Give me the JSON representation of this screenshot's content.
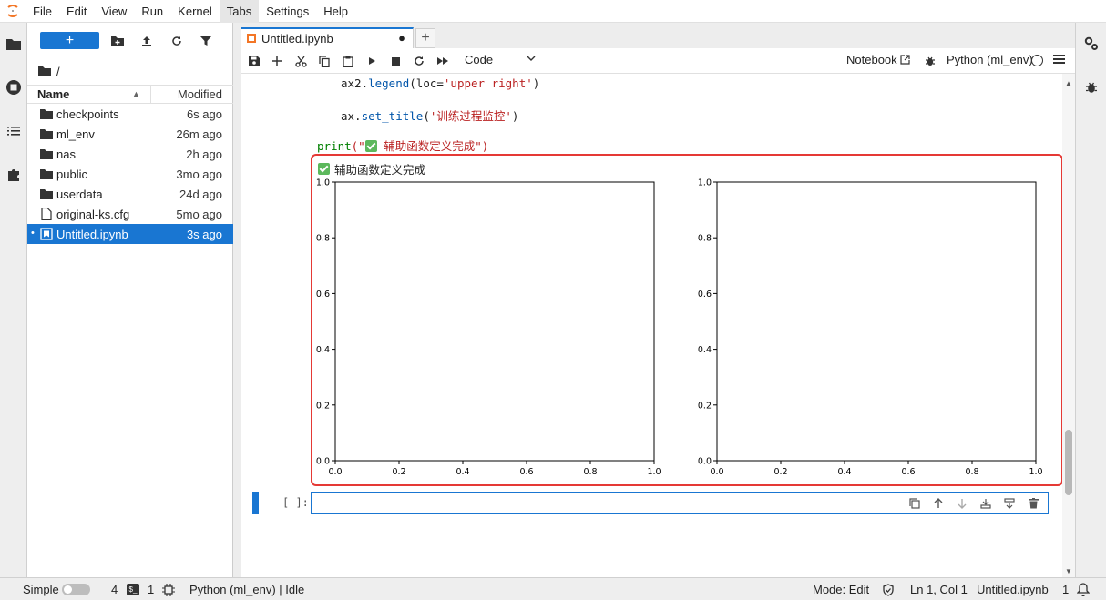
{
  "menubar": {
    "items": [
      "File",
      "Edit",
      "View",
      "Run",
      "Kernel",
      "Tabs",
      "Settings",
      "Help"
    ],
    "active": "Tabs"
  },
  "filebrowser": {
    "new_label": "+",
    "path": "/",
    "col_name": "Name",
    "col_modified": "Modified",
    "files": [
      {
        "name": "checkpoints",
        "modified": "6s ago",
        "type": "folder",
        "selected": false
      },
      {
        "name": "ml_env",
        "modified": "26m ago",
        "type": "folder",
        "selected": false
      },
      {
        "name": "nas",
        "modified": "2h ago",
        "type": "folder",
        "selected": false
      },
      {
        "name": "public",
        "modified": "3mo ago",
        "type": "folder",
        "selected": false
      },
      {
        "name": "userdata",
        "modified": "24d ago",
        "type": "folder",
        "selected": false
      },
      {
        "name": "original-ks.cfg",
        "modified": "5mo ago",
        "type": "file",
        "selected": false
      },
      {
        "name": "Untitled.ipynb",
        "modified": "3s ago",
        "type": "notebook",
        "selected": true
      }
    ]
  },
  "tab": {
    "label": "Untitled.ipynb",
    "dirty_mark": "●",
    "add_label": "+"
  },
  "toolbar": {
    "cell_type": "Code",
    "notebook_label": "Notebook",
    "kernel": "Python (ml_env)"
  },
  "code": {
    "line1": {
      "obj": "ax2.",
      "fn": "legend",
      "open": "(loc=",
      "str": "'upper right'",
      "close": ")"
    },
    "line2": {
      "obj": "ax.",
      "fn": "set_title",
      "open": "(",
      "str": "'训练过程监控'",
      "close": ")"
    },
    "line3": {
      "fn": "print",
      "open": "(\"",
      "str": " 辅助函数定义完成",
      "close": "\")"
    }
  },
  "output": {
    "text": "辅助函数定义完成"
  },
  "chart_data": [
    {
      "type": "line",
      "series": [],
      "xlim": [
        0.0,
        1.0
      ],
      "ylim": [
        0.0,
        1.0
      ],
      "xticks": [
        "0.0",
        "0.2",
        "0.4",
        "0.6",
        "0.8",
        "1.0"
      ],
      "yticks": [
        "0.0",
        "0.2",
        "0.4",
        "0.6",
        "0.8",
        "1.0"
      ],
      "grid": false
    },
    {
      "type": "line",
      "series": [],
      "xlim": [
        0.0,
        1.0
      ],
      "ylim": [
        0.0,
        1.0
      ],
      "xticks": [
        "0.0",
        "0.2",
        "0.4",
        "0.6",
        "0.8",
        "1.0"
      ],
      "yticks": [
        "0.0",
        "0.2",
        "0.4",
        "0.6",
        "0.8",
        "1.0"
      ],
      "grid": false
    }
  ],
  "prompt": "[ ]:",
  "statusbar": {
    "mode": "Simple",
    "terminals": "4",
    "kernels": "1",
    "kernel_status": "Python (ml_env) | Idle",
    "edit_mode": "Mode: Edit",
    "cursor": "Ln 1, Col 1",
    "filename": "Untitled.ipynb",
    "notifications": "1"
  },
  "colors": {
    "accent": "#1976d2",
    "highlight": "#e53935",
    "success": "#5cb85c"
  }
}
